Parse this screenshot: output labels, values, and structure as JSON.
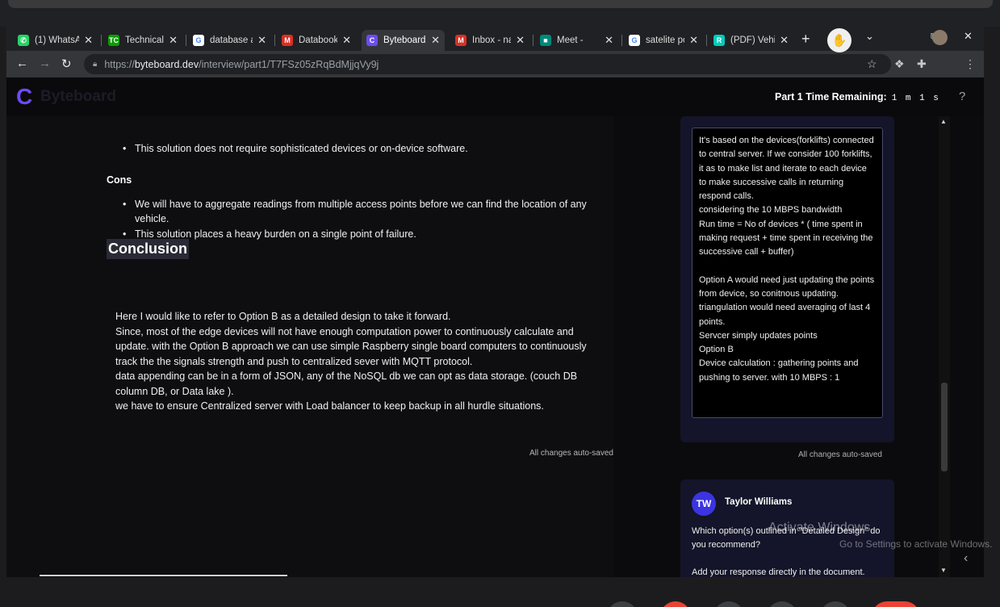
{
  "browser": {
    "tabs": [
      {
        "title": "(1) WhatsA",
        "icon": "whatsapp-icon",
        "color": "#25d366",
        "glyph": "✆"
      },
      {
        "title": "Technical i",
        "icon": "techcrunch-icon",
        "color": "#0a9e01",
        "glyph": "TC"
      },
      {
        "title": "database a",
        "icon": "google-icon",
        "color": "#ffffff",
        "glyph": "G"
      },
      {
        "title": "Databook",
        "icon": "gmail-icon",
        "color": "#d93025",
        "glyph": "M"
      },
      {
        "title": "Byteboard",
        "icon": "byteboard-icon",
        "color": "#6c4cf2",
        "glyph": "C"
      },
      {
        "title": "Inbox - na",
        "icon": "gmail-icon",
        "color": "#d93025",
        "glyph": "M"
      },
      {
        "title": "Meet -",
        "icon": "meet-icon",
        "color": "#00897b",
        "glyph": "■"
      },
      {
        "title": "satelite po",
        "icon": "google-icon",
        "color": "#ffffff",
        "glyph": "G"
      },
      {
        "title": "(PDF) Vehi",
        "icon": "researchgate-icon",
        "color": "#00ccbb",
        "glyph": "R"
      }
    ],
    "close_glyph": "✕",
    "new_tab": "+",
    "window_controls": {
      "menu": "⌄",
      "restore": "⧉",
      "close": "✕"
    },
    "url_prefix": "https://",
    "url_host": "byteboard.dev",
    "url_path": "/interview/part1/T7FSz05zRqBdMjjqVy9j"
  },
  "app": {
    "brand": "Byteboard",
    "timer_label": "Part 1 Time Remaining:",
    "timer_value": "1 m 1 s",
    "help": "?"
  },
  "document": {
    "pro_bullet": "This solution does not require sophisticated devices or on-device software.",
    "cons_heading": "Cons",
    "cons": [
      "We will have to aggregate readings from multiple access points before we can find the location of any vehicle.",
      "This solution places a heavy burden on a single point of failure."
    ],
    "conclusion_heading": "Conclusion",
    "conclusion_lines": [
      "Here I would like to refer to Option B as a detailed design to take it forward.",
      "Since, most of the edge devices will not have enough computation power to continuously calculate and update. with the Option B approach we can use simple Raspberry single board computers to continuously track the the signals strength and push to centralized sever with MQTT protocol.",
      "data appending can be in a form of JSON, any of the NoSQL db we can opt as data storage. (couch DB column DB,  or Data lake ).",
      "we have to ensure Centralized server with Load balancer to keep backup in all hurdle situations."
    ],
    "autosave": "All changes auto-saved"
  },
  "comments": {
    "response_lines": [
      "It's based on the devices(forklifts) connected to central server. If we consider 100 forklifts, it as to make list and iterate to each device to make successive calls in returning respond calls.",
      "considering the 10 MBPS bandwidth",
      "Run time =  No of devices * ( time spent in making request + time spent in receiving the successive call + buffer)",
      "",
      "Option A  would need just updating the points from device, so conitnous updating.",
      "triangulation would need averaging of last 4 points.",
      "Servcer simply updates points",
      "Option B",
      "Device calculation : gathering points and pushing to server.  with 10 MBPS : 1"
    ],
    "autosave": "All changes auto-saved",
    "author_initials": "TW",
    "author_name": "Taylor Williams",
    "question": "Which option(s) outlined in \"Detailed Design\" do you recommend?",
    "instruction": "Add your response directly in the document."
  },
  "overlay": {
    "activate_title": "Activate Windows",
    "activate_sub": "Go to Settings to activate Windows."
  }
}
